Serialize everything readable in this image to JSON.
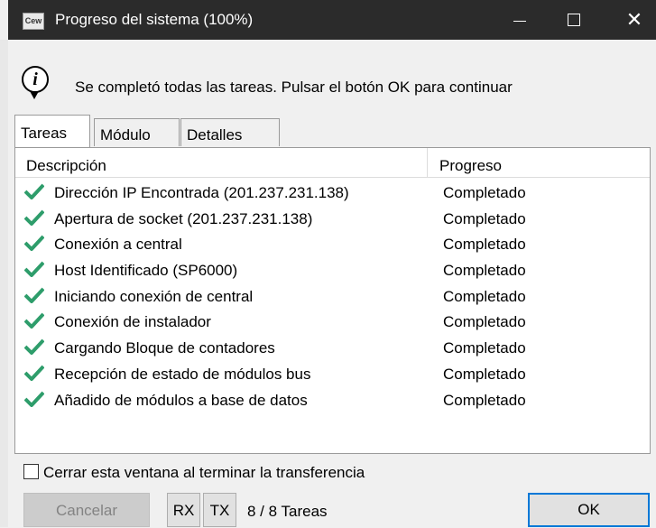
{
  "window": {
    "icon_text": "Cew",
    "title": "Progreso del sistema (100%)",
    "minimize_icon": "minimize-icon",
    "maximize_icon": "maximize-icon",
    "close_glyph": "✕"
  },
  "message": {
    "icon": "info-icon",
    "icon_text": "i",
    "text": "Se completó todas las tareas. Pulsar el botón OK para continuar"
  },
  "tabs": [
    {
      "label": "Tareas",
      "active": true
    },
    {
      "label": "Módulo",
      "active": false
    },
    {
      "label": "Detalles",
      "active": false
    }
  ],
  "table": {
    "columns": [
      "Descripción",
      "Progreso"
    ],
    "rows": [
      {
        "description": "Dirección IP Encontrada (201.237.231.138)",
        "status": "Completado"
      },
      {
        "description": "Apertura de socket (201.237.231.138)",
        "status": "Completado"
      },
      {
        "description": "Conexión a central",
        "status": "Completado"
      },
      {
        "description": "Host Identificado (SP6000)",
        "status": "Completado"
      },
      {
        "description": "Iniciando conexión de central",
        "status": "Completado"
      },
      {
        "description": "Conexión de instalador",
        "status": "Completado"
      },
      {
        "description": "Cargando Bloque de contadores",
        "status": "Completado"
      },
      {
        "description": "Recepción de estado de módulos bus",
        "status": "Completado"
      },
      {
        "description": "Añadido de módulos a base de datos",
        "status": "Completado"
      }
    ],
    "check_color": "#2e9d6b"
  },
  "options": {
    "close_on_finish_label": "Cerrar esta ventana al terminar la transferencia",
    "close_on_finish_checked": false
  },
  "footer": {
    "cancel_label": "Cancelar",
    "rx_label": "RX",
    "tx_label": "TX",
    "task_count": "8 / 8 Tareas",
    "ok_label": "OK"
  },
  "colors": {
    "titlebar": "#2b2b2b",
    "ok_border": "#0078d7"
  }
}
